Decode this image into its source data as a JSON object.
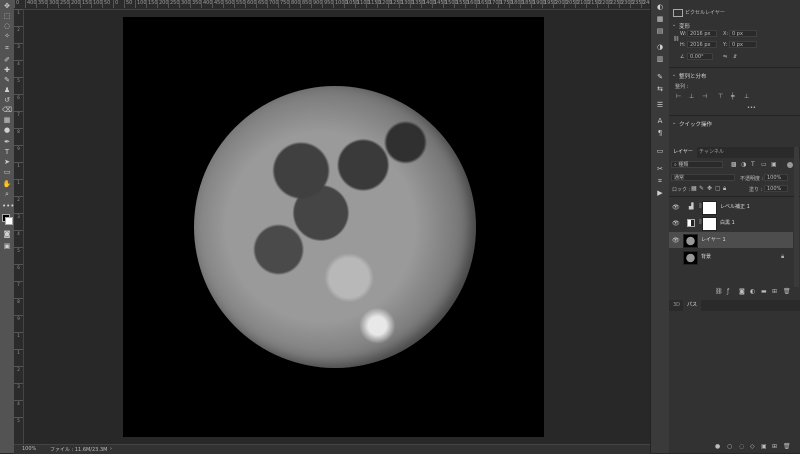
{
  "ruler": {
    "top_ticks": [
      "0",
      "400",
      "350",
      "300",
      "250",
      "200",
      "150",
      "100",
      "50",
      "0",
      "50",
      "100",
      "150",
      "200",
      "250",
      "300",
      "350",
      "400",
      "450",
      "500",
      "550",
      "600",
      "650",
      "700",
      "750",
      "800",
      "850",
      "900",
      "950",
      "1000",
      "1050",
      "1100",
      "1150",
      "1200",
      "1250",
      "1300",
      "1350",
      "1400",
      "1450",
      "1500",
      "1550",
      "1600",
      "1650",
      "1700",
      "1750",
      "1800",
      "1850",
      "1900",
      "1950",
      "2000",
      "2050",
      "2100",
      "2150",
      "2200",
      "2250",
      "2300",
      "2350",
      "2400"
    ],
    "left_ticks": [
      "1",
      "2",
      "3",
      "4",
      "5",
      "6",
      "7",
      "8",
      "9",
      "1",
      "1",
      "2",
      "3",
      "4",
      "5",
      "6",
      "7",
      "8",
      "9",
      "1",
      "1",
      "2",
      "3",
      "4",
      "5"
    ]
  },
  "toolbar": {
    "tools": [
      "move-icon",
      "marquee-icon",
      "lasso-icon",
      "magic-wand-icon",
      "crop-icon",
      "eyedropper-icon",
      "healing-icon",
      "brush-icon",
      "stamp-icon",
      "history-brush-icon",
      "eraser-icon",
      "gradient-icon",
      "dodge-icon",
      "pen-icon",
      "type-icon",
      "path-select-icon",
      "rectangle-icon",
      "hand-icon",
      "zoom-icon",
      "more-icon"
    ]
  },
  "status": {
    "zoom": "100%",
    "file_info": "ファイル : 11.6M/23.3M",
    "arrow": "›"
  },
  "properties": {
    "header": "ピクセルレイヤー",
    "transform_title": "変形",
    "w_label": "W:",
    "w_value": "2016 px",
    "h_label": "H:",
    "h_value": "2016 px",
    "x_label": "X:",
    "x_value": "0 px",
    "y_label": "Y:",
    "y_value": "0 px",
    "angle_value": "0.00°",
    "align_title": "整列と分布",
    "align_label": "整列 :",
    "more": "•••",
    "quick_title": "クイック操作"
  },
  "layers_panel": {
    "tab_layers": "レイヤー",
    "tab_channels": "チャンネル",
    "kind": "種類",
    "blend": "通常",
    "opacity_label": "不透明度 :",
    "opacity_value": "100%",
    "lock_label": "ロック :",
    "fill_label": "塗り :",
    "fill_value": "100%",
    "layers": [
      {
        "name": "レベル補正 1",
        "thumb": "white"
      },
      {
        "name": "白黒 1",
        "thumb": "white"
      },
      {
        "name": "レイヤー 1",
        "thumb": "moon",
        "selected": true
      },
      {
        "name": "背景",
        "thumb": "moon"
      }
    ]
  },
  "bottom_tabs": {
    "tab3d": "3D",
    "tab_paths": "パス"
  },
  "colors": {
    "selected_row": "#4d4d4d",
    "panel": "#323232",
    "canvas_bg": "#000000"
  }
}
